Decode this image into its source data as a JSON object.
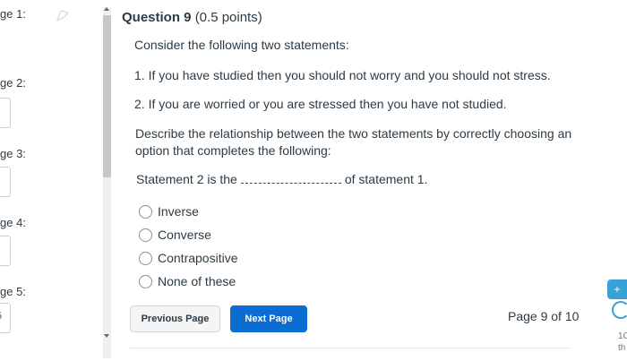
{
  "sidebar": {
    "pages": [
      {
        "label": "ge 1:"
      },
      {
        "label": "ge 2:"
      },
      {
        "label": "ge 3:"
      },
      {
        "label": "ge 4:"
      },
      {
        "label": "ge 5:",
        "box_text": "5"
      }
    ]
  },
  "question": {
    "title": "Question 9",
    "points": "(0.5 points)",
    "intro": "Consider the following two statements:",
    "statement1": "1. If you have studied then you should not worry and you should not stress.",
    "statement2": "2. If you are worried or you are stressed then you have not studied.",
    "prompt_line1": "Describe the relationship between the two statements by correctly choosing an",
    "prompt_line2": "option that completes the following:",
    "fill_before": "Statement 2 is the",
    "fill_after": "of statement 1.",
    "options": [
      "Inverse",
      "Converse",
      "Contrapositive",
      "None of these"
    ]
  },
  "footer": {
    "prev_label": "Previous Page",
    "next_label": "Next Page",
    "page_indicator": "Page 9 of 10"
  },
  "right_edge": {
    "fragments": [
      "1C",
      "th"
    ]
  },
  "colors": {
    "primary_button": "#0b6dd2",
    "text": "#2d3b45",
    "accent": "#3aa0d8"
  }
}
